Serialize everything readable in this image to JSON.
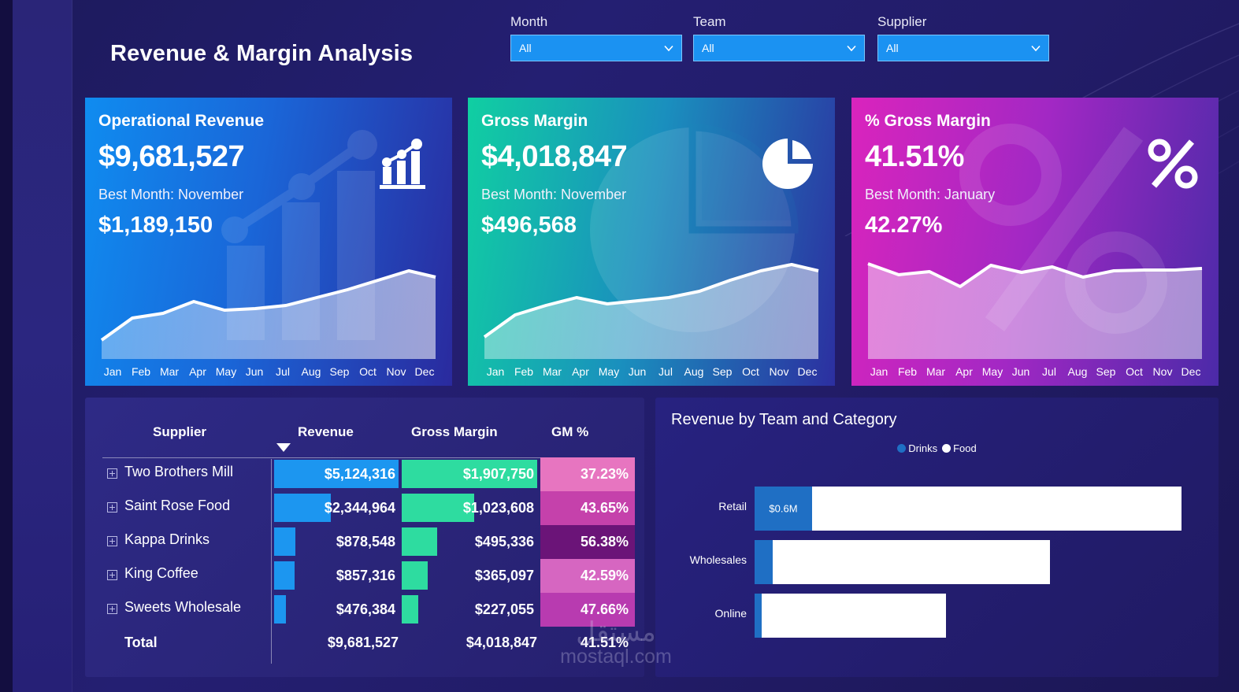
{
  "header": {
    "title": "Revenue & Margin Analysis"
  },
  "filters": [
    {
      "label": "Month",
      "value": "All",
      "icon": "chevron-down-icon"
    },
    {
      "label": "Team",
      "value": "All",
      "icon": "chevron-down-icon"
    },
    {
      "label": "Supplier",
      "value": "All",
      "icon": "chevron-down-icon"
    }
  ],
  "sidebar": {
    "items": [
      {
        "name": "revenue-growth-icon",
        "active": true
      },
      {
        "name": "balance-scale-icon",
        "active": false
      },
      {
        "name": "flask-icon",
        "active": false
      }
    ]
  },
  "kpis": [
    {
      "title": "Operational Revenue",
      "value": "$9,681,527",
      "sub_label": "Best Month: November",
      "sub_value": "$1,189,150",
      "icon": "bar-chart-growth-icon",
      "accent": "#0f8cf0"
    },
    {
      "title": "Gross Margin",
      "value": "$4,018,847",
      "sub_label": "Best Month: November",
      "sub_value": "$496,568",
      "icon": "pie-chart-icon",
      "accent": "#10cfa2"
    },
    {
      "title": "% Gross Margin",
      "value": "41.51%",
      "sub_label": "Best Month: January",
      "sub_value": "42.27%",
      "icon": "percent-icon",
      "accent": "#da24bd"
    }
  ],
  "months": [
    "Jan",
    "Feb",
    "Mar",
    "Apr",
    "May",
    "Jun",
    "Jul",
    "Aug",
    "Sep",
    "Oct",
    "Nov",
    "Dec"
  ],
  "table": {
    "headers": {
      "supplier": "Supplier",
      "revenue": "Revenue",
      "gross_margin": "Gross Margin",
      "gm_percent": "GM %"
    },
    "sort": "revenue-descending",
    "rows": [
      {
        "supplier": "Two Brothers Mill",
        "revenue": "$5,124,316",
        "gross_margin": "$1,907,750",
        "gm_percent": "37.23%",
        "revenue_ratio": 1.0,
        "gm_ratio": 1.0,
        "gmp_color": "#e775c0"
      },
      {
        "supplier": "Saint Rose Food",
        "revenue": "$2,344,964",
        "gross_margin": "$1,023,608",
        "gm_percent": "43.65%",
        "revenue_ratio": 0.458,
        "gm_ratio": 0.537,
        "gmp_color": "#c541ab"
      },
      {
        "supplier": "Kappa Drinks",
        "revenue": "$878,548",
        "gross_margin": "$495,336",
        "gm_percent": "56.38%",
        "revenue_ratio": 0.171,
        "gm_ratio": 0.26,
        "gmp_color": "#6b1478"
      },
      {
        "supplier": "King Coffee",
        "revenue": "$857,316",
        "gross_margin": "$365,097",
        "gm_percent": "42.59%",
        "revenue_ratio": 0.167,
        "gm_ratio": 0.191,
        "gmp_color": "#d666c1"
      },
      {
        "supplier": "Sweets Wholesale",
        "revenue": "$476,384",
        "gross_margin": "$227,055",
        "gm_percent": "47.66%",
        "revenue_ratio": 0.093,
        "gm_ratio": 0.119,
        "gmp_color": "#b83bb0"
      }
    ],
    "total": {
      "label": "Total",
      "revenue": "$9,681,527",
      "gross_margin": "$4,018,847",
      "gm_percent": "41.51%"
    },
    "bar_colors": {
      "revenue": "#1c96f0",
      "gross_margin": "#2edca0"
    }
  },
  "chart_data": {
    "type": "bar",
    "title": "Revenue by Team and Category",
    "orientation": "horizontal",
    "stacked": true,
    "categories": [
      "Retail",
      "Wholesales",
      "Online"
    ],
    "series": [
      {
        "name": "Drinks",
        "color": "#1f6fc4",
        "values": [
          0.6,
          0.2,
          0.05
        ],
        "labels": [
          "$0.6M",
          "",
          ""
        ]
      },
      {
        "name": "Food",
        "color": "#ffffff",
        "values": [
          4.6,
          3.5,
          2.2
        ],
        "labels": [
          "",
          "",
          ""
        ]
      }
    ],
    "legend_position": "top",
    "xlabel": "",
    "ylabel": "",
    "grid": false
  },
  "sparklines": {
    "operational_revenue": {
      "type": "area",
      "x": [
        "Jan",
        "Feb",
        "Mar",
        "Apr",
        "May",
        "Jun",
        "Jul",
        "Aug",
        "Sep",
        "Oct",
        "Nov",
        "Dec"
      ],
      "values": [
        0.18,
        0.4,
        0.46,
        0.58,
        0.49,
        0.51,
        0.54,
        0.62,
        0.7,
        0.8,
        0.92,
        0.86
      ]
    },
    "gross_margin": {
      "type": "area",
      "x": [
        "Jan",
        "Feb",
        "Mar",
        "Apr",
        "May",
        "Jun",
        "Jul",
        "Aug",
        "Sep",
        "Oct",
        "Nov",
        "Dec"
      ],
      "values": [
        0.2,
        0.44,
        0.52,
        0.6,
        0.53,
        0.56,
        0.59,
        0.66,
        0.76,
        0.87,
        0.95,
        0.89
      ]
    },
    "pct_gross_margin": {
      "type": "area",
      "x": [
        "Jan",
        "Feb",
        "Mar",
        "Apr",
        "May",
        "Jun",
        "Jul",
        "Aug",
        "Sep",
        "Oct",
        "Nov",
        "Dec"
      ],
      "values": [
        0.96,
        0.87,
        0.9,
        0.78,
        0.94,
        0.89,
        0.93,
        0.85,
        0.9,
        0.91,
        0.91,
        0.92
      ]
    }
  },
  "watermark": {
    "arabic": "مستقل",
    "latin": "mostaql.com"
  }
}
